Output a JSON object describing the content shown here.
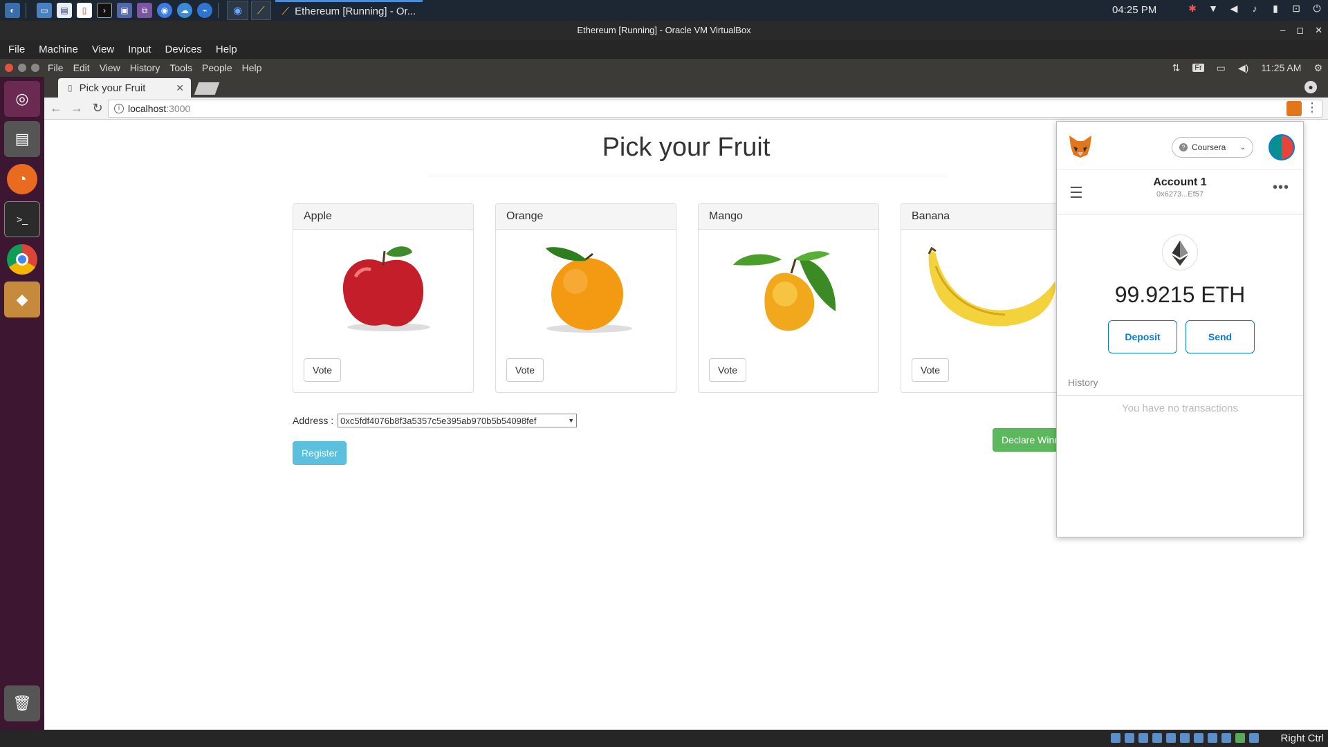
{
  "host_taskbar": {
    "active_task_label": "Ethereum [Running] - Or...",
    "clock": "04:25 PM"
  },
  "vbox": {
    "window_title": "Ethereum [Running] - Oracle VM VirtualBox",
    "menu": [
      "File",
      "Machine",
      "View",
      "Input",
      "Devices",
      "Help"
    ],
    "status_right": "Right Ctrl"
  },
  "guest": {
    "app_menu": [
      "File",
      "Edit",
      "View",
      "History",
      "Tools",
      "People",
      "Help"
    ],
    "keyboard_layout": "Fr",
    "clock": "11:25 AM"
  },
  "browser": {
    "tab_title": "Pick your Fruit",
    "url_host": "localhost",
    "url_port": ":3000"
  },
  "page": {
    "title": "Pick your Fruit",
    "fruits": [
      {
        "name": "Apple",
        "vote_label": "Vote"
      },
      {
        "name": "Orange",
        "vote_label": "Vote"
      },
      {
        "name": "Mango",
        "vote_label": "Vote"
      },
      {
        "name": "Banana",
        "vote_label": "Vote"
      }
    ],
    "address_label": "Address :",
    "address_value": "0xc5fdf4076b8f3a5357c5e395ab970b5b54098fef",
    "register_label": "Register",
    "declare_label": "Declare Winner"
  },
  "metamask": {
    "network": "Coursera",
    "account_name": "Account 1",
    "account_address": "0x6273...Ef57",
    "balance": "99.9215 ETH",
    "deposit_label": "Deposit",
    "send_label": "Send",
    "history_label": "History",
    "empty_text": "You have no transactions"
  },
  "colors": {
    "register": "#5bc0de",
    "declare": "#5cb85c",
    "metamask_blue": "#037dd6",
    "launcher": "#3d1631"
  }
}
